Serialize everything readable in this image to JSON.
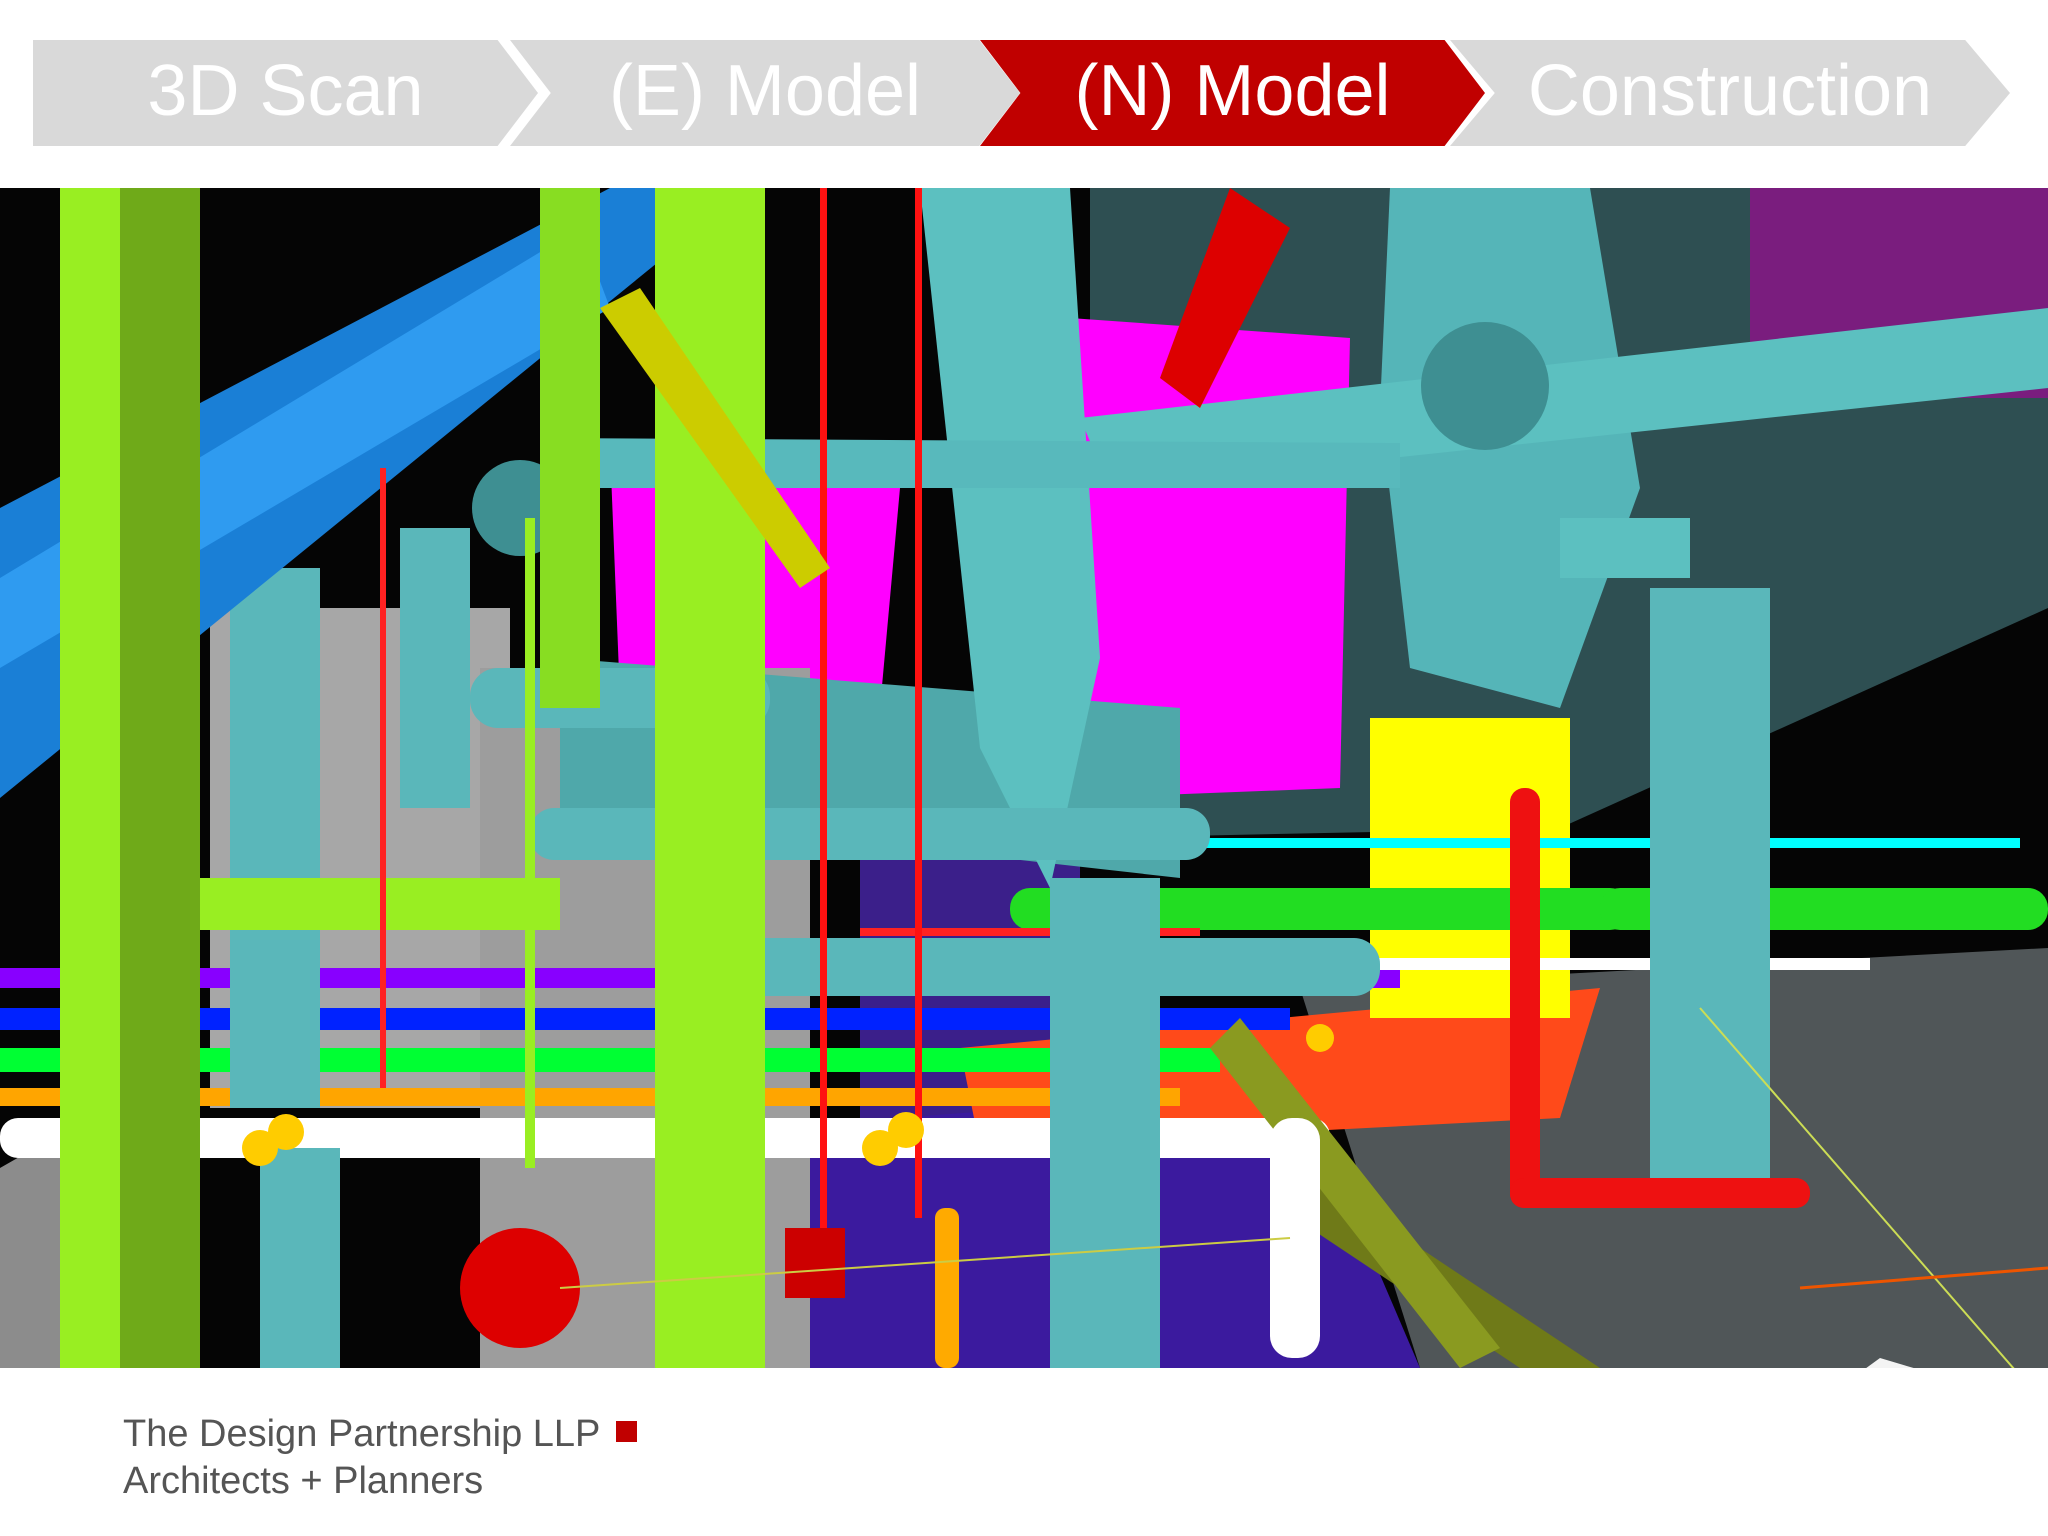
{
  "process_steps": [
    {
      "label": "3D Scan",
      "state": "inactive"
    },
    {
      "label": "(E) Model",
      "state": "inactive"
    },
    {
      "label": "(N) Model",
      "state": "active"
    },
    {
      "label": "Construction",
      "state": "inactive"
    }
  ],
  "colors": {
    "inactive_step": "#d9d9d9",
    "active_step": "#c00000",
    "step_text": "#ffffff",
    "footer_text": "#555555",
    "brand_square": "#c00000"
  },
  "scene": {
    "visual": "3D BIM model of piping, ductwork and structural framing"
  },
  "footer": {
    "company": "The Design Partnership LLP",
    "tagline": "Architects + Planners"
  }
}
